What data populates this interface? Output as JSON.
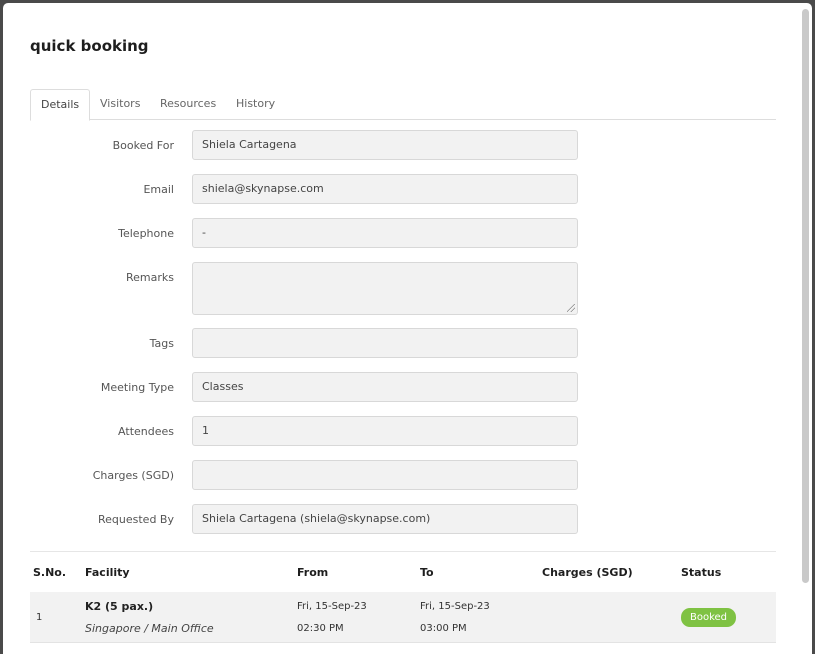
{
  "title": "quick booking",
  "tabs": [
    {
      "label": "Details",
      "active": true
    },
    {
      "label": "Visitors",
      "active": false
    },
    {
      "label": "Resources",
      "active": false
    },
    {
      "label": "History",
      "active": false
    }
  ],
  "form": {
    "booked_for": {
      "label": "Booked For",
      "value": "Shiela Cartagena"
    },
    "email": {
      "label": "Email",
      "value": "shiela@skynapse.com"
    },
    "telephone": {
      "label": "Telephone",
      "value": "-"
    },
    "remarks": {
      "label": "Remarks",
      "value": ""
    },
    "tags": {
      "label": "Tags",
      "value": ""
    },
    "meeting_type": {
      "label": "Meeting Type",
      "value": "Classes"
    },
    "attendees": {
      "label": "Attendees",
      "value": "1"
    },
    "charges": {
      "label": "Charges (SGD)",
      "value": ""
    },
    "requested_by": {
      "label": "Requested By",
      "value": "Shiela Cartagena (shiela@skynapse.com)"
    }
  },
  "table": {
    "columns": [
      "S.No.",
      "Facility",
      "From",
      "To",
      "Charges (SGD)",
      "Status"
    ],
    "rows": [
      {
        "sno": "1",
        "facility": "K2 (5 pax.)",
        "location": "Singapore / Main Office",
        "from_date": "Fri, 15-Sep-23",
        "from_time": "02:30 PM",
        "to_date": "Fri, 15-Sep-23",
        "to_time": "03:00 PM",
        "charges": "",
        "status": "Booked"
      }
    ]
  },
  "colors": {
    "status_booked": "#7fc243",
    "field_bg": "#f2f2f2"
  }
}
